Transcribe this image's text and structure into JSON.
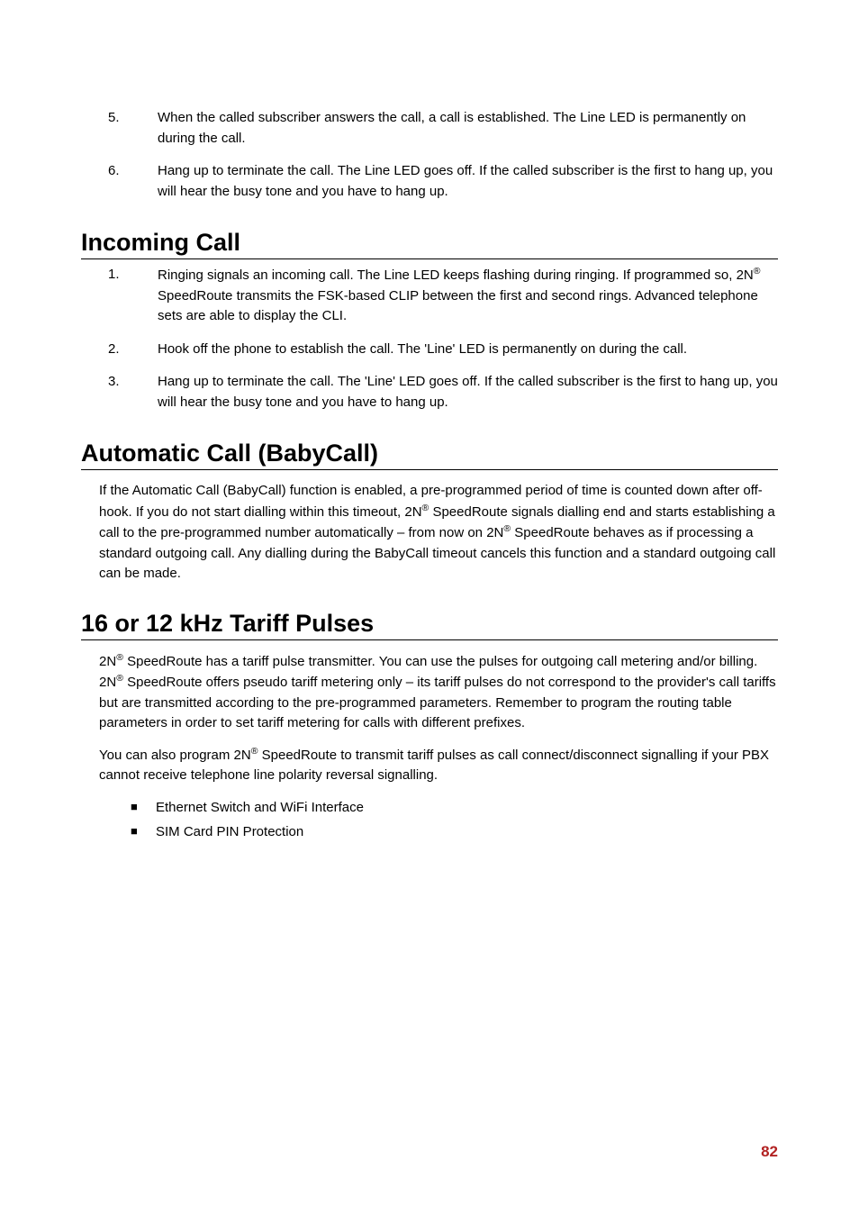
{
  "intro_list": [
    {
      "num": "5.",
      "text_html": "When the called subscriber answers the call, a call is established. The Line LED is permanently on during the call."
    },
    {
      "num": "6.",
      "text_html": "Hang up to terminate the call. The Line LED goes off. If the called subscriber is the first to hang up, you will hear the busy tone and you have to hang up."
    }
  ],
  "section1": {
    "title": "Incoming Call",
    "list": [
      {
        "num": "1.",
        "text_html": "Ringing signals an incoming call. The Line LED keeps flashing during ringing. If programmed so, 2N<sup>®</sup> SpeedRoute transmits the FSK-based CLIP between the first and second rings. Advanced telephone sets are able to display the CLI."
      },
      {
        "num": "2.",
        "text_html": "Hook off the phone to establish the call. The 'Line' LED is permanently on during the call."
      },
      {
        "num": "3.",
        "text_html": "Hang up to terminate the call. The 'Line' LED goes off. If the called subscriber is the first to hang up, you will hear the busy tone and you have to hang up."
      }
    ]
  },
  "section2": {
    "title": "Automatic Call (BabyCall)",
    "para_html": "If the Automatic Call (BabyCall) function is enabled, a pre-programmed period of time is counted down after off-hook. If you do not start dialling within this timeout, 2N<sup>®</sup> SpeedRoute signals dialling end and starts establishing a call to the pre-programmed number automatically – from now on 2N<sup>®</sup> SpeedRoute behaves as if processing a standard outgoing call. Any dialling during the BabyCall timeout cancels this function and a standard outgoing call can be made."
  },
  "section3": {
    "title": "16 or 12 kHz Tariff Pulses",
    "para1_html": "2N<sup>®</sup> SpeedRoute has a tariff pulse transmitter. You can use the pulses for outgoing call metering and/or billing. 2N<sup>®</sup> SpeedRoute offers pseudo tariff metering only – its tariff pulses do not correspond to the provider's call tariffs but are transmitted according to the pre-programmed parameters. Remember to program the routing table parameters in order to set tariff metering for calls with different prefixes.",
    "para2_html": "You can also program 2N<sup>®</sup> SpeedRoute to transmit tariff pulses as call connect/disconnect signalling if your PBX cannot receive telephone line polarity reversal signalling.",
    "bullets": [
      "Ethernet Switch and WiFi Interface",
      "SIM Card PIN Protection"
    ]
  },
  "page_number": "82"
}
